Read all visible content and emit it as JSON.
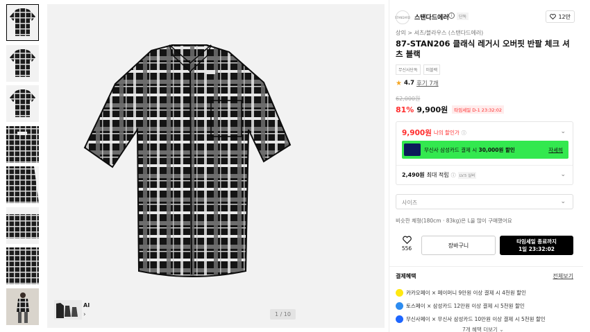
{
  "gallery": {
    "counter": "1 / 10",
    "ai_label": "AI",
    "thumbnail_count": 8
  },
  "brand": {
    "logo_text": "STANDARD",
    "name": "스탠다드에러",
    "tag": "단독",
    "likes": "12만"
  },
  "product": {
    "breadcrumb": "상의 > 셔츠/블라우스 (스탠다드에러)",
    "title": "87-STAN206 클래식 레거시 오버핏 반팔 체크 셔츠 블랙",
    "chips": [
      "무신사단독",
      "미블랙"
    ],
    "rating": "4.7",
    "review_link": "후기 7개",
    "original_price": "62,000원",
    "discount": "81%",
    "price": "9,900원",
    "timesale": "타임세일 D-1 23:32:02"
  },
  "benefits": {
    "my_price": "9,900원",
    "my_price_label": "나의 할인가",
    "info_icon": "ⓘ",
    "card_text_pre": "무신사 삼성카드 결제 시",
    "card_text_amount": "30,000원 할인",
    "card_detail": "자세히",
    "points_amount": "2,490원",
    "points_label": "최대 적립",
    "points_level": "LV.5 실버"
  },
  "size": {
    "placeholder": "사이즈",
    "hint": "비슷한 체형(180cm · 83kg)은 L을 많이 구매했어요"
  },
  "actions": {
    "like_count": "556",
    "cart": "장바구니",
    "buy_line1": "타임세일 종료까지",
    "buy_line2": "1일 23:32:02"
  },
  "payment": {
    "title": "결제혜택",
    "view_all": "전체보기",
    "items": [
      {
        "text": "카카오페이 × 페이머니 9만원 이상 결제 시 4천원 할인",
        "color": "#ffe812"
      },
      {
        "text": "토스페이 × 삼성카드 12만원 이상 결제 시 5천원 할인",
        "color": "#2d8cf0"
      },
      {
        "text": "무신사페이 × 무신사 삼성카드 10만원 이상 결제 시 5천원 할인",
        "color": "#1e66ff"
      }
    ],
    "more": "7개 혜택 더보기"
  },
  "colors": {
    "accent_red": "#ff2b2b",
    "card_banner": "#33e84f",
    "buy_button": "#000000"
  }
}
